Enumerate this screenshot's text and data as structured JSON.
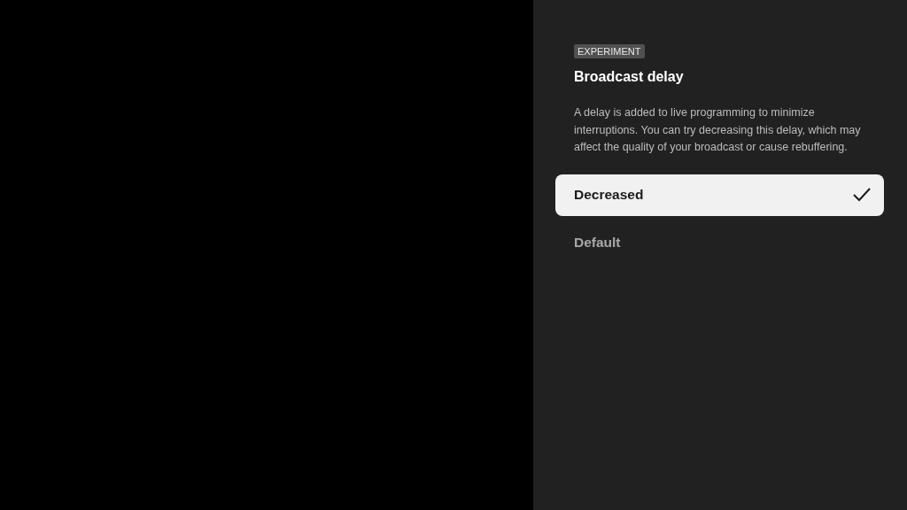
{
  "panel": {
    "badge": "EXPERIMENT",
    "title": "Broadcast delay",
    "description": "A delay is added to live programming to minimize interruptions. You can try decreasing this delay, which may affect the quality of your broadcast or cause rebuffering.",
    "options": [
      {
        "label": "Decreased",
        "selected": true
      },
      {
        "label": "Default",
        "selected": false
      }
    ]
  }
}
